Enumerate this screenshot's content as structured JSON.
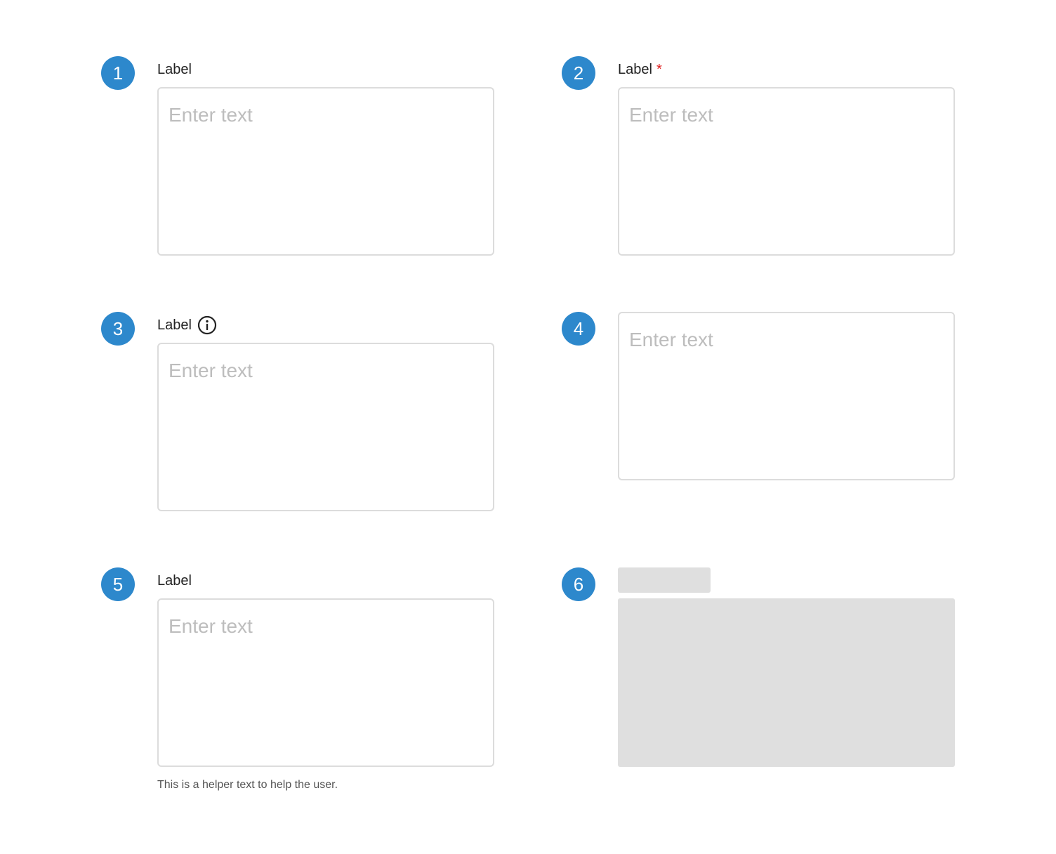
{
  "examples": [
    {
      "number": "1",
      "label": "Label",
      "placeholder": "Enter text"
    },
    {
      "number": "2",
      "label": "Label",
      "required_marker": "*",
      "placeholder": "Enter text"
    },
    {
      "number": "3",
      "label": "Label",
      "info_icon": "info-circle-icon",
      "placeholder": "Enter text"
    },
    {
      "number": "4",
      "placeholder": "Enter text"
    },
    {
      "number": "5",
      "label": "Label",
      "placeholder": "Enter text",
      "helper_text": "This is a helper text to help the user."
    },
    {
      "number": "6",
      "state": "skeleton-loading"
    }
  ],
  "colors": {
    "badge": "#2d88cc",
    "border": "#dcdcdc",
    "placeholder": "#bdbdbd",
    "required": "#e02020",
    "skeleton": "#dfdfdf",
    "text": "#222222"
  }
}
